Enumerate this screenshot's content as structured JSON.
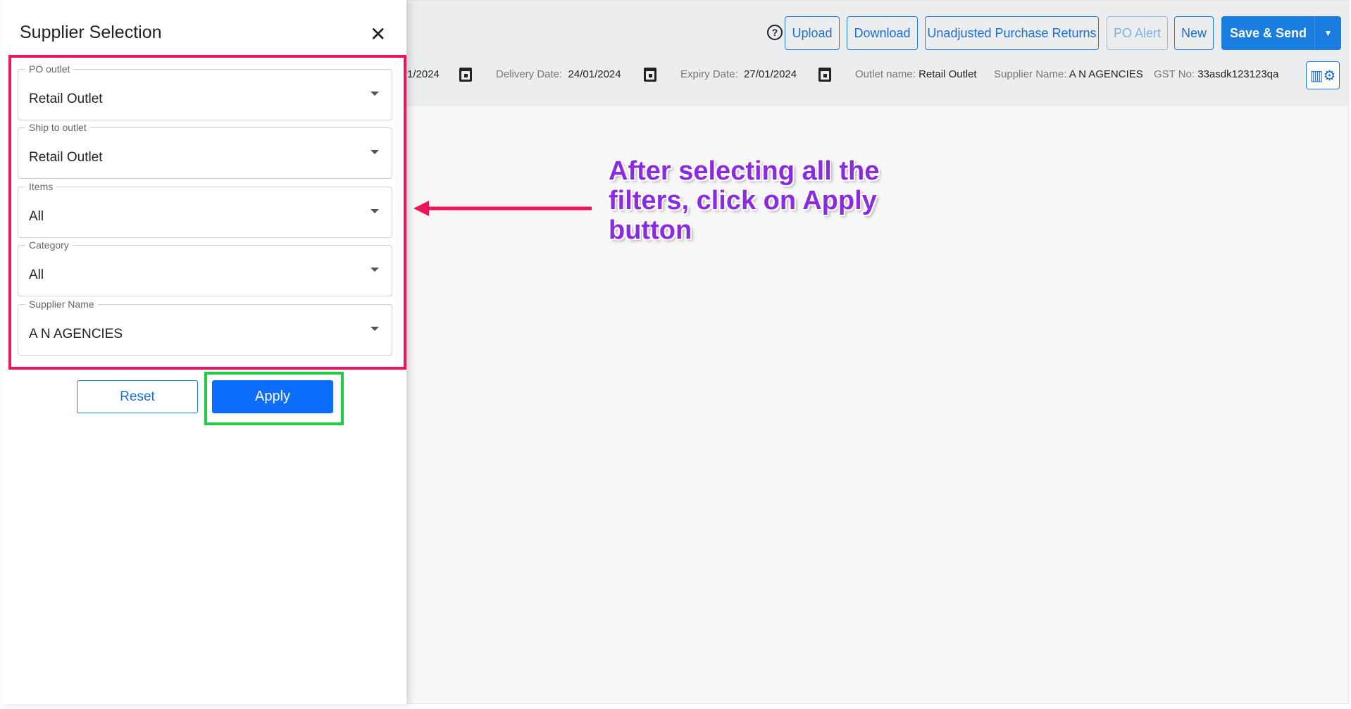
{
  "toolbar": {
    "upload": "Upload",
    "download": "Download",
    "unadjusted": "Unadjusted Purchase Returns",
    "po_alert": "PO Alert",
    "new": "New",
    "save_send": "Save & Send"
  },
  "info": {
    "order_date_partial": "1/2024",
    "delivery_label": "Delivery Date:",
    "delivery_value": "24/01/2024",
    "expiry_label": "Expiry Date:",
    "expiry_value": "27/01/2024",
    "outlet_label": "Outlet name:",
    "outlet_value": "Retail Outlet",
    "supplier_label": "Supplier Name:",
    "supplier_value": "A N AGENCIES",
    "gst_label": "GST No:",
    "gst_value": "33asdk123123qa"
  },
  "panel": {
    "title": "Supplier Selection",
    "fields": [
      {
        "label": "PO outlet",
        "value": "Retail Outlet"
      },
      {
        "label": "Ship to outlet",
        "value": "Retail Outlet"
      },
      {
        "label": "Items",
        "value": "All"
      },
      {
        "label": "Category",
        "value": "All"
      },
      {
        "label": "Supplier Name",
        "value": "A N AGENCIES"
      }
    ],
    "reset": "Reset",
    "apply": "Apply"
  },
  "annotation": "After selecting all the filters, click on Apply button",
  "colors": {
    "accent": "#1a7de0",
    "highlight_red": "#f0145a",
    "highlight_green": "#22cc44",
    "annotation": "#8a2be2"
  }
}
